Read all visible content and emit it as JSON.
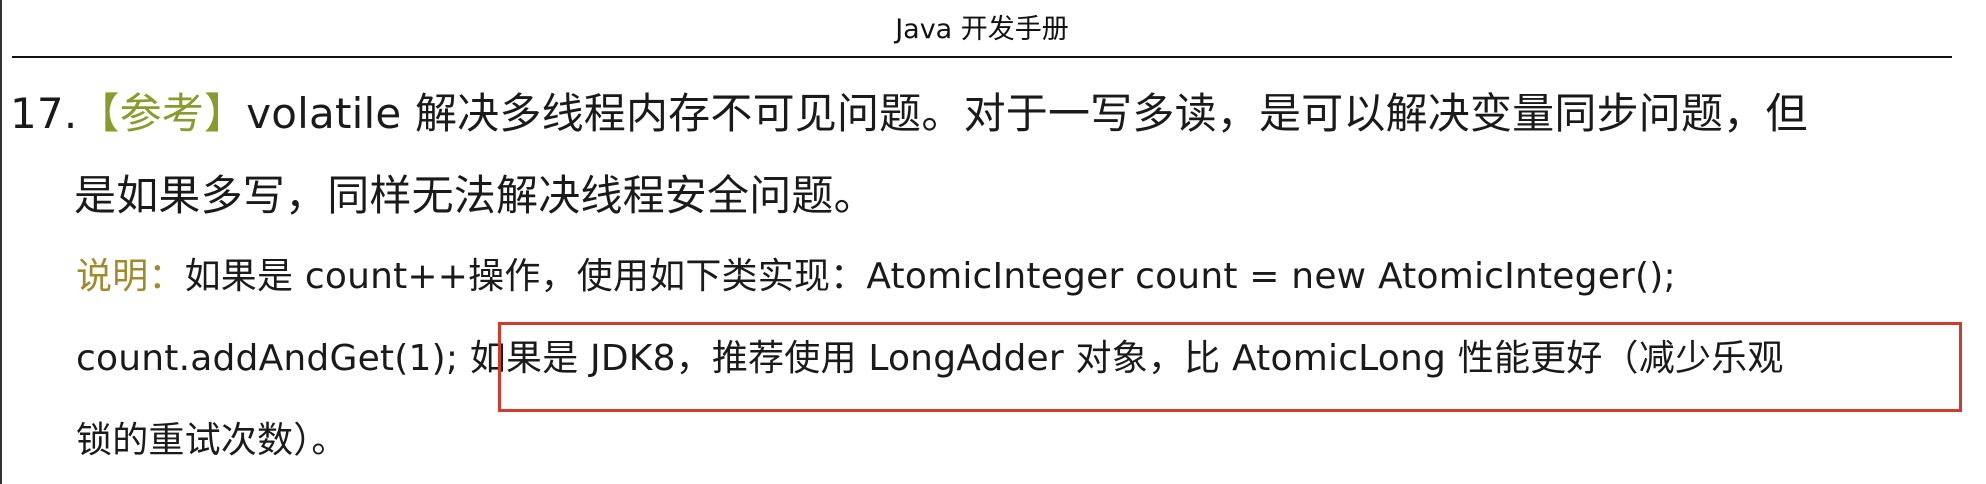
{
  "header": {
    "title": "Java 开发手册"
  },
  "rule": {
    "number": "17.",
    "tag": "【参考】",
    "line1": "volatile 解决多线程内存不可见问题。对于一写多读，是可以解决变量同步问题，但",
    "line2": "是如果多写，同样无法解决线程安全问题。"
  },
  "note": {
    "label": "说明：",
    "line1": "如果是 count++操作，使用如下类实现：AtomicInteger count = new AtomicInteger();",
    "line2_pre": "count.addAndGet(1); ",
    "line2_highlight": "如果是 JDK8，推荐使用 LongAdder 对象，比 AtomicLong 性能更好（减少乐观",
    "line3": "锁的重试次数）。"
  },
  "colors": {
    "tag": "#8a9a2b",
    "note_label": "#a08a2e",
    "highlight_border": "#d33a2c"
  }
}
